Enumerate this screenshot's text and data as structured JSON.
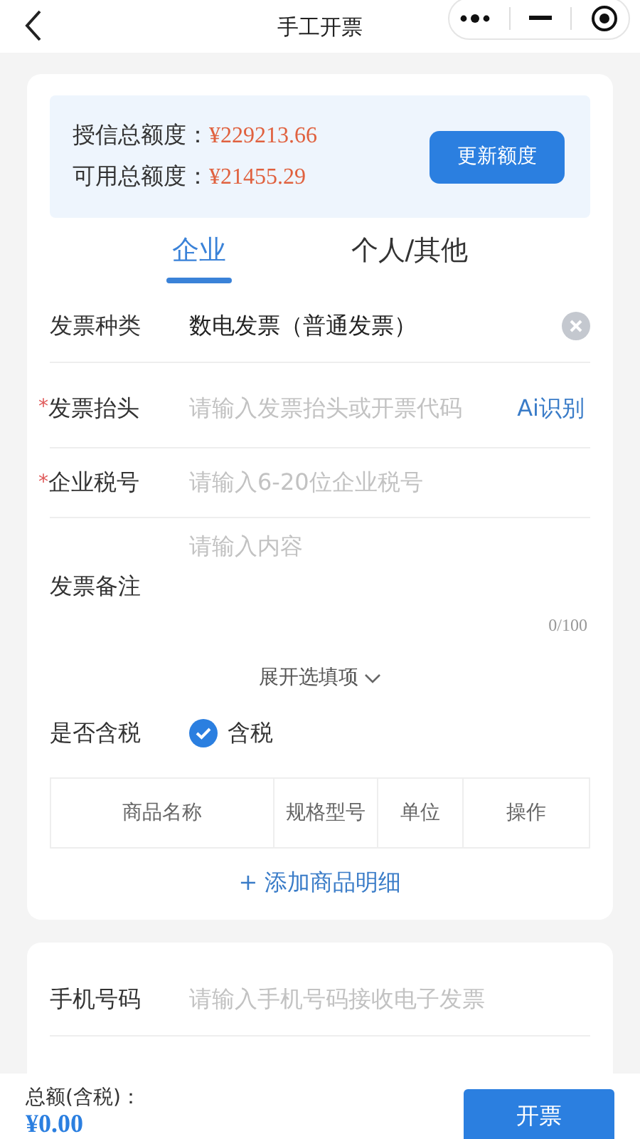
{
  "nav": {
    "title": "手工开票"
  },
  "quota": {
    "rows": [
      {
        "label": "授信总额度：",
        "value": "¥229213.66"
      },
      {
        "label": "可用总额度：",
        "value": "¥21455.29"
      }
    ],
    "button": "更新额度"
  },
  "tabs": [
    {
      "label": "企业",
      "selected": true
    },
    {
      "label": "个人/其他",
      "selected": false
    }
  ],
  "fields": [
    {
      "kind": "select",
      "label": "发票种类",
      "value": "数电发票（普通发票）"
    },
    {
      "kind": "text",
      "label": "发票抬头",
      "required_mark": "*",
      "placeholder": "请输入发票抬头或开票代码",
      "action": "Ai识别"
    },
    {
      "kind": "text",
      "label": "企业税号",
      "required_mark": "*",
      "placeholder": "请输入6-20位企业税号"
    },
    {
      "kind": "textarea",
      "label": "发票备注",
      "placeholder": "请输入内容",
      "counter": "0/100"
    }
  ],
  "expand": "展开选填项",
  "tax": {
    "label": "是否含税",
    "option": "含税",
    "checked": true
  },
  "table": {
    "columns": [
      "商品名称",
      "规格型号",
      "单位",
      "操作"
    ]
  },
  "add_item": "+ 添加商品明细",
  "contact": [
    {
      "label": "手机号码",
      "placeholder": "请输入手机号码接收电子发票"
    }
  ],
  "footer": {
    "total_label": "总额(含税)：",
    "total": "¥0.00",
    "button": "开票"
  }
}
